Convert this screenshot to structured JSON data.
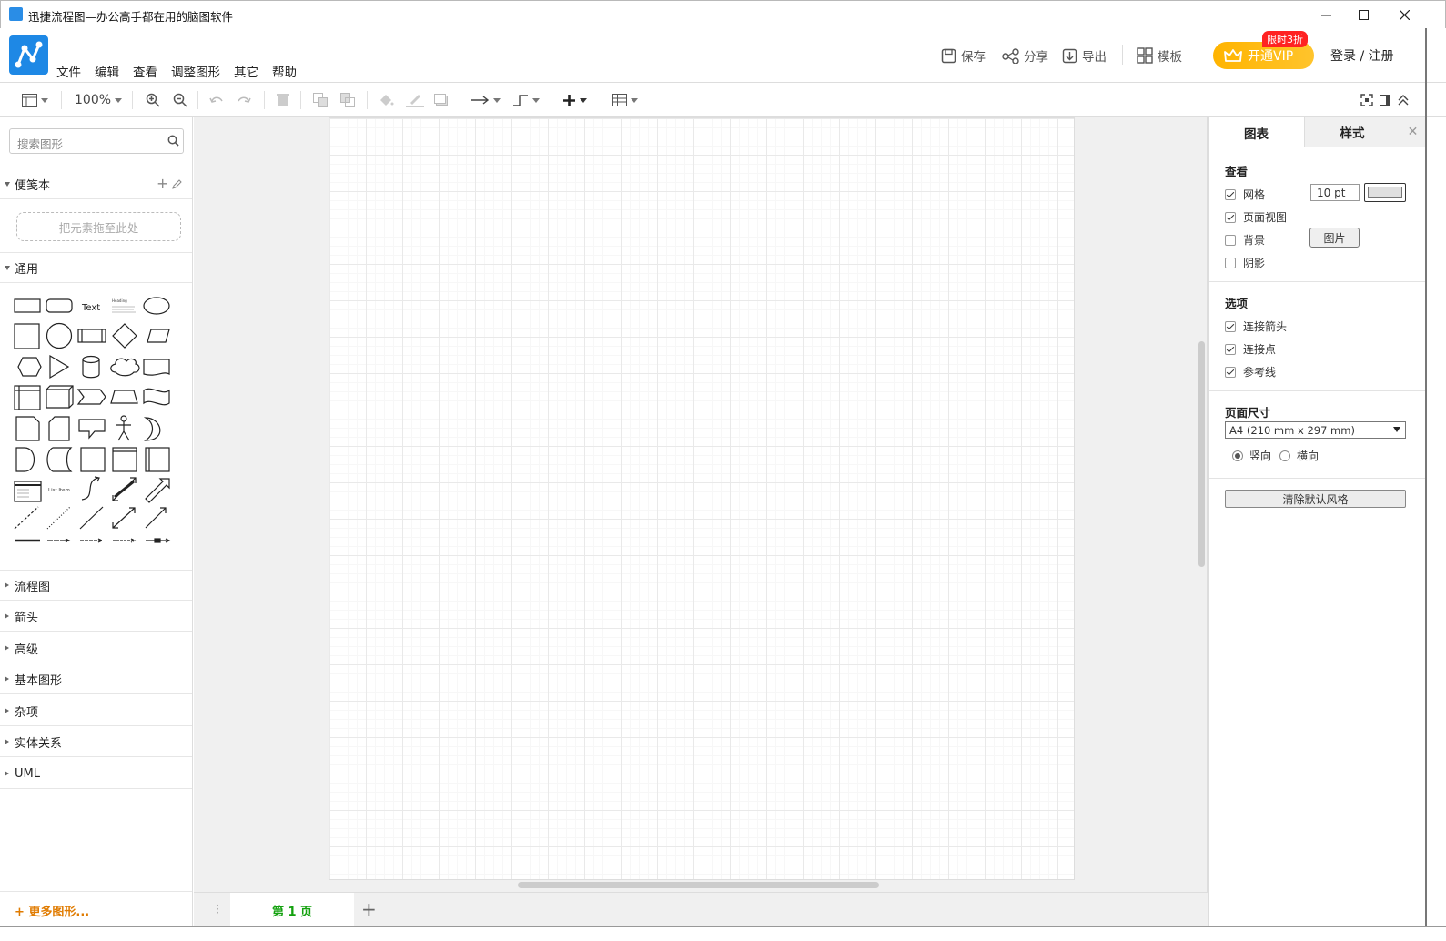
{
  "window": {
    "title": "迅捷流程图—办公高手都在用的脑图软件",
    "minimize_icon": "minimize-icon",
    "maximize_icon": "maximize-icon",
    "close_icon": "close-icon"
  },
  "menu": [
    "文件",
    "编辑",
    "查看",
    "调整图形",
    "其它",
    "帮助"
  ],
  "header": {
    "save": "保存",
    "share": "分享",
    "export": "导出",
    "template": "模板",
    "vip_label": "开通VIP",
    "vip_badge": "限时3折",
    "login": "登录 / 注册"
  },
  "toolbar": {
    "zoom": "100%"
  },
  "left": {
    "search_placeholder": "搜索图形",
    "scratchpad": "便笺本",
    "dropzone": "把元素拖至此处",
    "general": "通用",
    "shape_text": "Text",
    "shape_heading": "Heading",
    "shape_list_item": "List Item",
    "categories": [
      "流程图",
      "箭头",
      "高级",
      "基本图形",
      "杂项",
      "实体关系",
      "UML"
    ],
    "more_shapes": "+ 更多图形..."
  },
  "center": {
    "page_tab": "第 1 页"
  },
  "right": {
    "tab_diagram": "图表",
    "tab_style": "样式",
    "view_title": "查看",
    "grid": "网格",
    "grid_size": "10 pt",
    "page_view": "页面视图",
    "background": "背景",
    "image_btn": "图片",
    "shadow": "阴影",
    "options_title": "选项",
    "conn_arrows": "连接箭头",
    "conn_points": "连接点",
    "guides": "参考线",
    "pagesize_title": "页面尺寸",
    "pagesize_value": "A4 (210 mm x 297 mm)",
    "portrait": "竖向",
    "landscape": "横向",
    "clear_style": "清除默认风格",
    "checks": {
      "grid": true,
      "page_view": true,
      "background": false,
      "shadow": false,
      "conn_arrows": true,
      "conn_points": true,
      "guides": true
    }
  },
  "colors": {
    "brand": "#1e88e5",
    "vip": "#ffb400",
    "badge": "#ff2222",
    "page_tab": "#13a10e",
    "more": "#e07b00"
  }
}
